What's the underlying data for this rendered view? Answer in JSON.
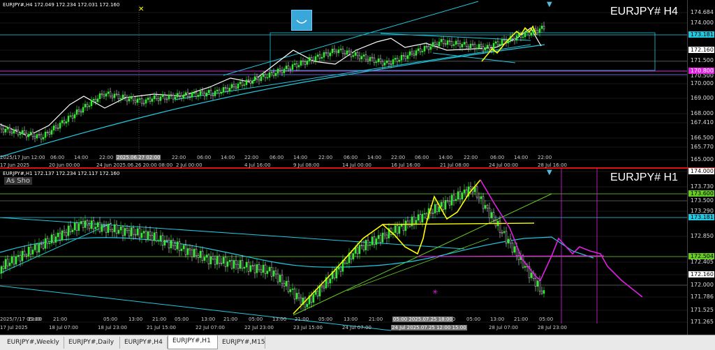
{
  "top": {
    "symbol_info": "EURJPY#,H4  172.049 172.234 172.031 172.160",
    "big_label": "EURJPY#  H4",
    "price_labels": [
      "174.684",
      "174.000",
      "173.181",
      "172.160",
      "171.500",
      "170.800",
      "170.500",
      "170.000",
      "169.000",
      "168.000",
      "167.410",
      "166.500",
      "165.770",
      "165.000"
    ],
    "tags": {
      "cyan": "173.181",
      "white": "172.160",
      "magenta": "170.800"
    },
    "time_labels": [
      "2025/17 Jun 12:00",
      "06:00",
      "14:00",
      "22:00",
      "2025.06.27 02:00",
      "22:00",
      "06:00",
      "14:00",
      "22:00",
      "06:00",
      "14:00",
      "22:00",
      "06:00",
      "14:00",
      "22:00",
      "06:00",
      "14:00",
      "22:00",
      "06:00",
      "14:00",
      "22:00"
    ],
    "time_labels2": [
      "17 Jun 2025",
      "20 Jun 00:00",
      "24 Jun 2025.06.26 20:00 08:00",
      "2 Jul 00:00",
      "4 Jul 16:00",
      "9 Jul 08:00",
      "14 Jul 00:00",
      "16 Jul 16:00",
      "21 Jul 08:00",
      "24 Jul 00:00",
      "28 Jul 16:00"
    ]
  },
  "bottom": {
    "symbol_info": "EURJPY#,H1  172.137 172.234 172.117 172.160",
    "button_label": "As Sho",
    "big_label": "EURJPY#  H1",
    "price_labels": [
      "174.000",
      "173.730",
      "173.600",
      "173.500",
      "173.290",
      "173.181",
      "172.850",
      "172.504",
      "172.405",
      "172.160",
      "172.000",
      "171.786",
      "171.525",
      "171.265"
    ],
    "tags": {
      "white_top": "174.000",
      "green": "173.600",
      "cyan": "173.181",
      "green2": "172.504",
      "white": "172.160"
    },
    "time_labels_top": [
      "2025/7/17 05:00",
      "13:00",
      "21:00",
      "05:00",
      "13:00",
      "21:00",
      "05:00",
      "13:00",
      "21:00",
      "05:00",
      "13:00",
      "21:00",
      "05:00",
      "13:00",
      "21:00",
      "05:00",
      "13:00",
      "21:00",
      "05:00 2025.07.25 18:00",
      "05:00",
      "13:00",
      "21:00",
      "05:00"
    ],
    "time_labels_bot": [
      "17 Jul 2025",
      "18 Jul 07:00",
      "18 Jul 23:00",
      "21 Jul 15:00",
      "22 Jul 07:00",
      "22 Jul 23:00",
      "23 Jul 15:00",
      "24 Jul 07:00",
      "24 Jul 2025.07.25 12:00 15:00",
      "28 Jul 07:00",
      "28 Jul 23:00"
    ]
  },
  "tabs": [
    "EURJPY#,Weekly",
    "EURJPY#,Daily",
    "EURJPY#,H4",
    "EURJPY#,H1",
    "EURJPY#,M15"
  ],
  "active_tab": "EURJPY#,H1",
  "colors": {
    "cyan": "#22c8e0",
    "magenta": "#e020e0",
    "yellow": "#ffff00",
    "green": "#66cc22",
    "up": "#33ee33",
    "down": "#dddddd"
  }
}
